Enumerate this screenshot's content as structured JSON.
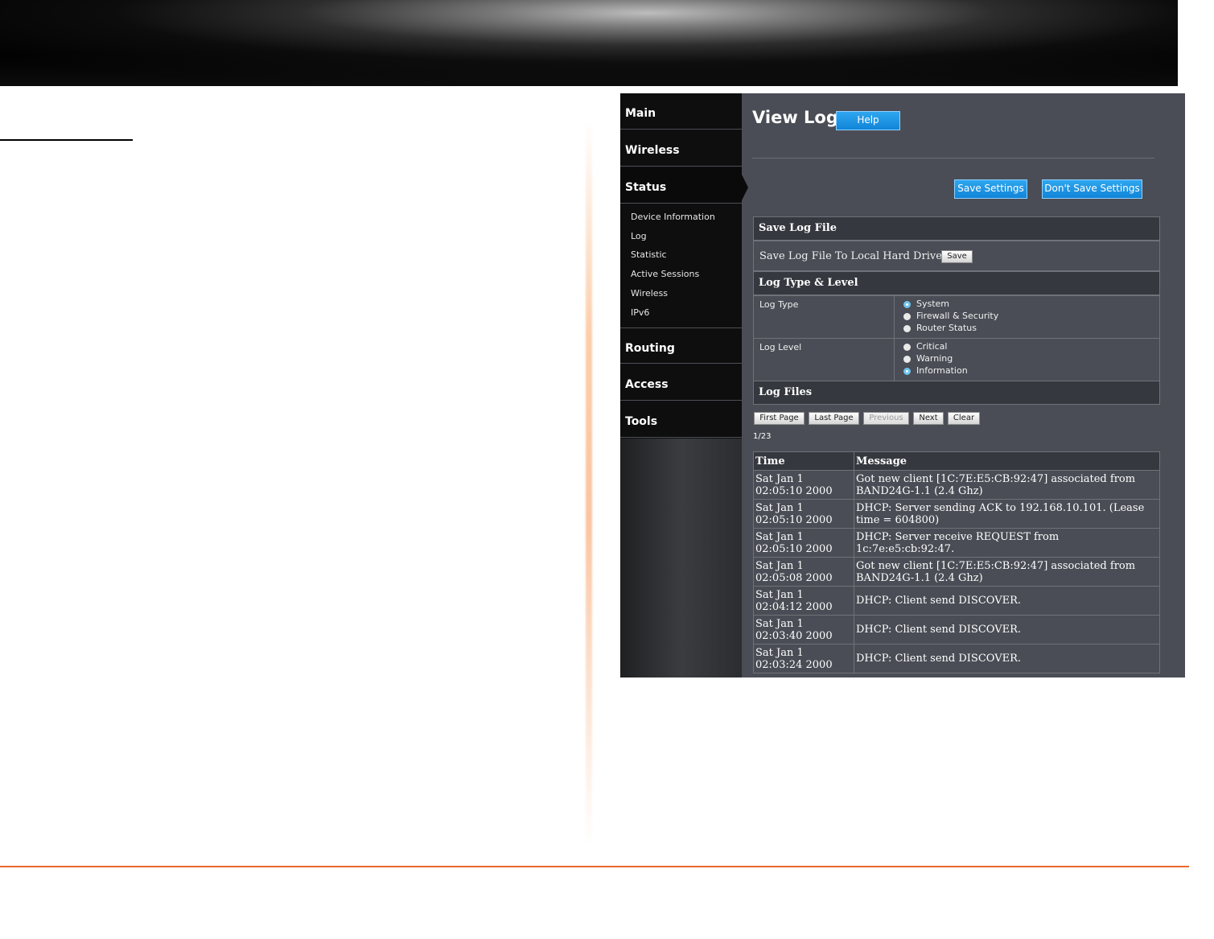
{
  "sidebar": {
    "main": "Main",
    "wireless": "Wireless",
    "status": "Status",
    "status_items": [
      "Device Information",
      "Log",
      "Statistic",
      "Active Sessions",
      "Wireless",
      "IPv6"
    ],
    "routing": "Routing",
    "access": "Access",
    "tools": "Tools"
  },
  "header": {
    "title": "View Log",
    "help": "Help",
    "save_settings": "Save Settings",
    "dont_save_settings": "Don't Save Settings"
  },
  "save_log": {
    "heading": "Save Log File",
    "text": "Save Log File To Local Hard Drive.",
    "button": "Save"
  },
  "log_type_level": {
    "heading": "Log Type & Level",
    "type_label": "Log Type",
    "types": [
      "System",
      "Firewall & Security",
      "Router Status"
    ],
    "type_selected": "System",
    "level_label": "Log Level",
    "levels": [
      "Critical",
      "Warning",
      "Information"
    ],
    "level_selected": "Information"
  },
  "log_files": {
    "heading": "Log Files",
    "buttons": {
      "first": "First Page",
      "last": "Last Page",
      "previous": "Previous",
      "next": "Next",
      "clear": "Clear"
    },
    "page": "1/23",
    "columns": {
      "time": "Time",
      "message": "Message"
    },
    "rows": [
      {
        "time_line1": "Sat Jan 1",
        "time_line2": "02:05:10 2000",
        "message": "Got new client [1C:7E:E5:CB:92:47] associated from BAND24G-1.1 (2.4 Ghz)"
      },
      {
        "time_line1": "Sat Jan 1",
        "time_line2": "02:05:10 2000",
        "message": "DHCP: Server sending ACK to 192.168.10.101. (Lease time = 604800)"
      },
      {
        "time_line1": "Sat Jan 1",
        "time_line2": "02:05:10 2000",
        "message": "DHCP: Server receive REQUEST from 1c:7e:e5:cb:92:47."
      },
      {
        "time_line1": "Sat Jan 1",
        "time_line2": "02:05:08 2000",
        "message": "Got new client [1C:7E:E5:CB:92:47] associated from BAND24G-1.1 (2.4 Ghz)"
      },
      {
        "time_line1": "Sat Jan 1",
        "time_line2": "02:04:12 2000",
        "message": "DHCP: Client send DISCOVER."
      },
      {
        "time_line1": "Sat Jan 1",
        "time_line2": "02:03:40 2000",
        "message": "DHCP: Client send DISCOVER."
      },
      {
        "time_line1": "Sat Jan 1",
        "time_line2": "02:03:24 2000",
        "message": "DHCP: Client send DISCOVER."
      }
    ]
  }
}
